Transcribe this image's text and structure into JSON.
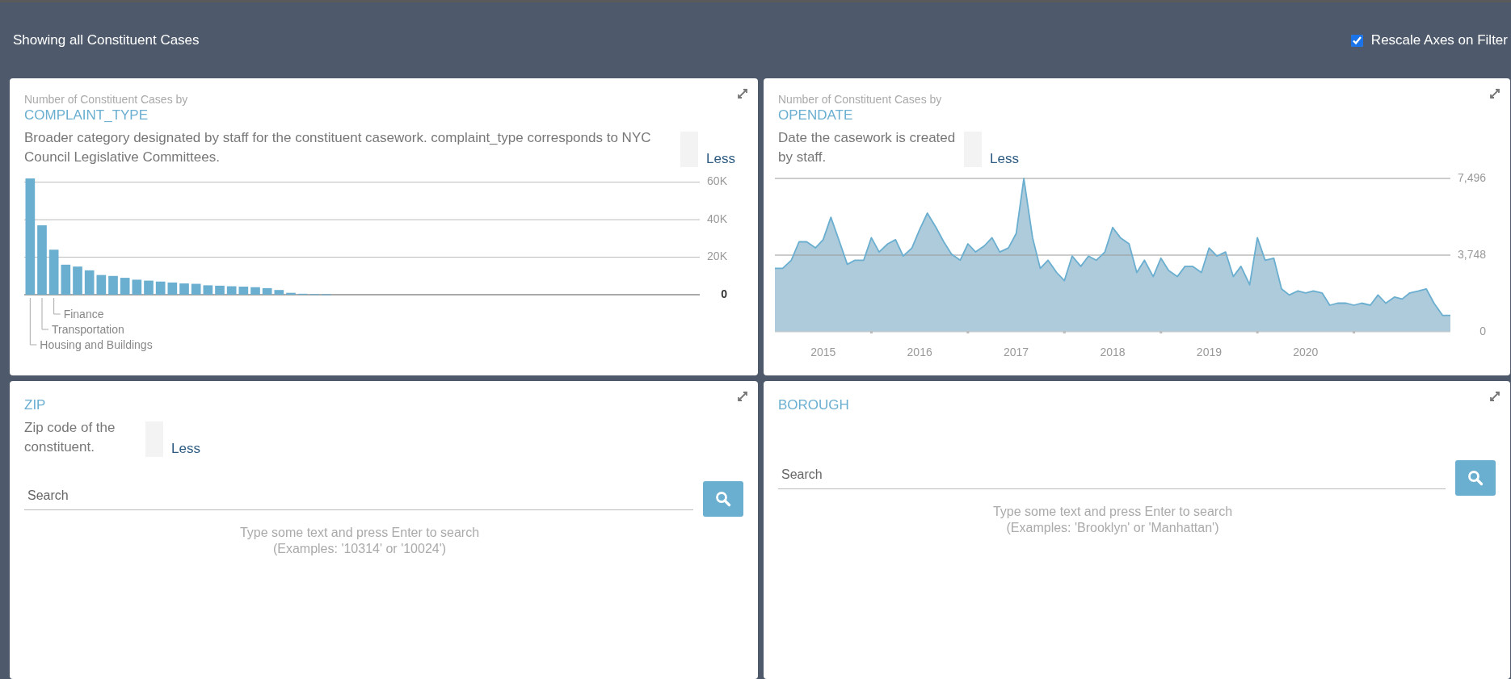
{
  "header": {
    "title": "Showing all Constituent Cases",
    "rescale": {
      "label": "Rescale Axes on Filter",
      "checked": true
    }
  },
  "cards": [
    {
      "kind": "bar_chart",
      "subtitle": "Number of Constituent Cases by",
      "title": "COMPLAINT_TYPE",
      "description": "Broader category designated by staff for the constituent casework. complaint_type corresponds to NYC Council Legislative Committees.",
      "toggle": "Less",
      "bar_labels": [
        "Finance",
        "Transportation",
        "Housing and Buildings"
      ],
      "chart_data": {
        "type": "bar",
        "values": [
          62000,
          37000,
          24000,
          16000,
          15000,
          13000,
          10500,
          10000,
          9000,
          8000,
          7500,
          7000,
          6500,
          6000,
          5800,
          5000,
          4800,
          4500,
          4300,
          4000,
          3500,
          2500,
          1000,
          500,
          300,
          200,
          0,
          0,
          0,
          0,
          0,
          0,
          0,
          0,
          0,
          0,
          0,
          0,
          0,
          0,
          0,
          0,
          0,
          0,
          0,
          0,
          0,
          0,
          0,
          0,
          0,
          0,
          0,
          0,
          0,
          0,
          0
        ],
        "ylim": [
          0,
          62000
        ],
        "grid": true,
        "yticks": [
          {
            "value": 0,
            "label": "0"
          },
          {
            "value": 20000,
            "label": "20K"
          },
          {
            "value": 40000,
            "label": "40K"
          },
          {
            "value": 60000,
            "label": "60K"
          }
        ]
      }
    },
    {
      "kind": "line_chart",
      "subtitle": "Number of Constituent Cases by",
      "title": "OPENDATE",
      "description": "Date the casework is created by staff.",
      "toggle": "Less",
      "chart_data": {
        "type": "area",
        "x": [
          2014.5,
          2014.58,
          2014.67,
          2014.75,
          2014.83,
          2014.92,
          2015,
          2015.08,
          2015.17,
          2015.25,
          2015.33,
          2015.42,
          2015.5,
          2015.58,
          2015.67,
          2015.75,
          2015.83,
          2015.92,
          2016,
          2016.08,
          2016.17,
          2016.25,
          2016.33,
          2016.42,
          2016.5,
          2016.58,
          2016.67,
          2016.75,
          2016.83,
          2016.92,
          2017,
          2017.08,
          2017.17,
          2017.25,
          2017.33,
          2017.42,
          2017.5,
          2017.58,
          2017.67,
          2017.75,
          2017.83,
          2017.92,
          2018,
          2018.08,
          2018.17,
          2018.25,
          2018.33,
          2018.42,
          2018.5,
          2018.58,
          2018.67,
          2018.75,
          2018.83,
          2018.92,
          2019,
          2019.08,
          2019.17,
          2019.25,
          2019.33,
          2019.42,
          2019.5,
          2019.58,
          2019.67,
          2019.75,
          2019.83,
          2019.92,
          2020,
          2020.08,
          2020.17,
          2020.25,
          2020.33,
          2020.42,
          2020.5,
          2020.58,
          2020.67,
          2020.75,
          2020.83,
          2020.92,
          2021,
          2021.08,
          2021.17,
          2021.25,
          2021.33,
          2021.42,
          2021.5
        ],
        "values": [
          3100,
          3100,
          3500,
          4400,
          4400,
          4100,
          4500,
          5600,
          4400,
          3300,
          3500,
          3500,
          4600,
          3900,
          4300,
          4500,
          3700,
          4100,
          5000,
          5800,
          5100,
          4400,
          3800,
          3500,
          4300,
          3900,
          4200,
          4600,
          3900,
          4100,
          4800,
          7490,
          4600,
          3100,
          3500,
          2900,
          2500,
          3700,
          3200,
          3700,
          3500,
          3900,
          5100,
          4600,
          4300,
          2900,
          3500,
          2700,
          3600,
          3000,
          2700,
          3200,
          3200,
          2900,
          4100,
          3700,
          3900,
          2700,
          3200,
          2300,
          4600,
          3500,
          3600,
          2100,
          1800,
          2000,
          1900,
          2000,
          1900,
          1300,
          1400,
          1400,
          1300,
          1400,
          1300,
          1800,
          1400,
          1700,
          1600,
          1900,
          2000,
          2100,
          1400,
          800,
          800
        ],
        "xlim": [
          2014.5,
          2021.5
        ],
        "ylim": [
          0,
          7496
        ],
        "grid": true,
        "yticks": [
          {
            "value": 0,
            "label": "0"
          },
          {
            "value": 3748,
            "label": "3,748"
          },
          {
            "value": 7496,
            "label": "7,496"
          }
        ],
        "xticks": [
          2015,
          2016,
          2017,
          2018,
          2019,
          2020
        ]
      }
    },
    {
      "kind": "search",
      "title": "ZIP",
      "description": "Zip code of the constituent.",
      "toggle": "Less",
      "search": {
        "placeholder": "Search"
      },
      "hint": [
        "Type some text and press Enter to search",
        "(Examples: '10314' or '10024')"
      ]
    },
    {
      "kind": "search",
      "title": "BOROUGH",
      "search": {
        "placeholder": "Search"
      },
      "hint": [
        "Type some text and press Enter to search",
        "(Examples: 'Brooklyn' or 'Manhattan')"
      ]
    }
  ]
}
